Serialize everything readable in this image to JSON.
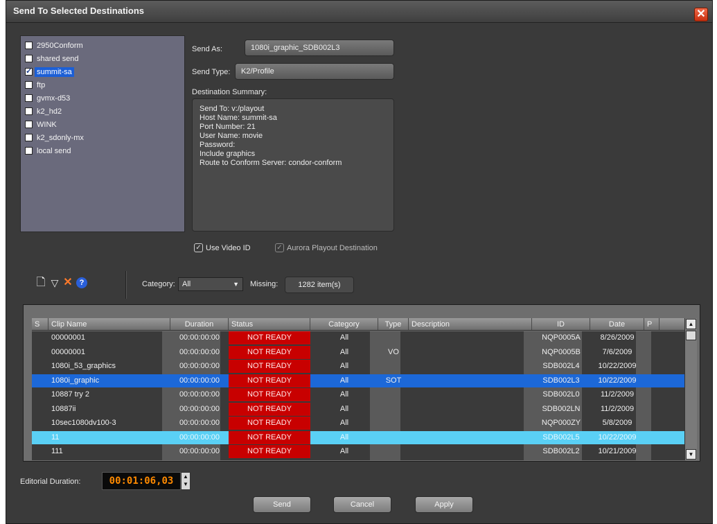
{
  "window": {
    "title": "Send To Selected Destinations",
    "close_glyph": "✕"
  },
  "destinations": [
    {
      "label": "2950Conform",
      "checked": false,
      "selected": false
    },
    {
      "label": "shared send",
      "checked": false,
      "selected": false
    },
    {
      "label": "summit-sa",
      "checked": true,
      "selected": true
    },
    {
      "label": "ftp",
      "checked": false,
      "selected": false
    },
    {
      "label": "gvmx-d53",
      "checked": false,
      "selected": false
    },
    {
      "label": "k2_hd2",
      "checked": false,
      "selected": false
    },
    {
      "label": "WINK",
      "checked": false,
      "selected": false
    },
    {
      "label": "k2_sdonly-mx",
      "checked": false,
      "selected": false
    },
    {
      "label": "local send",
      "checked": false,
      "selected": false
    }
  ],
  "form": {
    "send_as_label": "Send As:",
    "send_as_value": "1080i_graphic_SDB002L3",
    "send_type_label": "Send Type:",
    "send_type_value": "K2/Profile",
    "summary_label": "Destination Summary:",
    "summary_lines": [
      "Send To: v:/playout",
      "Host Name: summit-sa",
      "Port Number: 21",
      "User Name: movie",
      "Password:",
      "Include graphics",
      "Route to Conform Server: condor-conform"
    ],
    "use_video_id": "Use Video ID",
    "aurora_playout": "Aurora Playout Destination"
  },
  "toolbar": {
    "icons": [
      "new-document-icon",
      "filter-icon",
      "delete-icon",
      "help-icon"
    ],
    "category_label": "Category:",
    "category_value": "All",
    "missing_label": "Missing:",
    "missing_value": "1282 item(s)"
  },
  "table": {
    "headers": [
      "S",
      "Clip Name",
      "Duration",
      "Status",
      "Category",
      "Type",
      "Description",
      "ID",
      "Date",
      "P"
    ],
    "rows": [
      {
        "s": "",
        "name": "00000001",
        "duration": "00:00:00:00",
        "status": "NOT READY",
        "category": "All",
        "type": "",
        "description": "",
        "id": "NQP0005A",
        "date": "8/26/2009",
        "p": "",
        "state": ""
      },
      {
        "s": "",
        "name": "00000001",
        "duration": "00:00:00:00",
        "status": "NOT READY",
        "category": "All",
        "type": "VO",
        "description": "",
        "id": "NQP0005B",
        "date": "7/6/2009",
        "p": "",
        "state": ""
      },
      {
        "s": "",
        "name": "1080i_53_graphics",
        "duration": "00:00:00:00",
        "status": "NOT READY",
        "category": "All",
        "type": "",
        "description": "",
        "id": "SDB002L4",
        "date": "10/22/2009",
        "p": "",
        "state": ""
      },
      {
        "s": "",
        "name": "1080i_graphic",
        "duration": "00:00:00:00",
        "status": "NOT READY",
        "category": "All",
        "type": "SOT",
        "description": "",
        "id": "SDB002L3",
        "date": "10/22/2009",
        "p": "",
        "state": "sel-dark"
      },
      {
        "s": "",
        "name": "10887 try 2",
        "duration": "00:00:00:00",
        "status": "NOT READY",
        "category": "All",
        "type": "",
        "description": "",
        "id": "SDB002L0",
        "date": "11/2/2009",
        "p": "",
        "state": ""
      },
      {
        "s": "",
        "name": "10887ii",
        "duration": "00:00:00:00",
        "status": "NOT READY",
        "category": "All",
        "type": "",
        "description": "",
        "id": "SDB002LN",
        "date": "11/2/2009",
        "p": "",
        "state": ""
      },
      {
        "s": "",
        "name": "10sec1080dv100-3",
        "duration": "00:00:00:00",
        "status": "NOT READY",
        "category": "All",
        "type": "",
        "description": "",
        "id": "NQP000ZY",
        "date": "5/8/2009",
        "p": "",
        "state": ""
      },
      {
        "s": "",
        "name": "11",
        "duration": "00:00:00:00",
        "status": "NOT READY",
        "category": "All",
        "type": "",
        "description": "",
        "id": "SDB002L5",
        "date": "10/22/2009",
        "p": "",
        "state": "sel-light"
      },
      {
        "s": "",
        "name": "111",
        "duration": "00:00:00:00",
        "status": "NOT READY",
        "category": "All",
        "type": "",
        "description": "",
        "id": "SDB002L2",
        "date": "10/21/2009",
        "p": "",
        "state": ""
      }
    ]
  },
  "footer": {
    "editorial_duration_label": "Editorial Duration:",
    "editorial_duration_value": "00:01:06,03",
    "send_label": "Send",
    "cancel_label": "Cancel",
    "apply_label": "Apply"
  },
  "colors": {
    "status_not_ready": "#c80000",
    "selection_dark": "#1c68d8",
    "selection_light": "#5ad0f5",
    "timecode": "#ff8a00"
  }
}
